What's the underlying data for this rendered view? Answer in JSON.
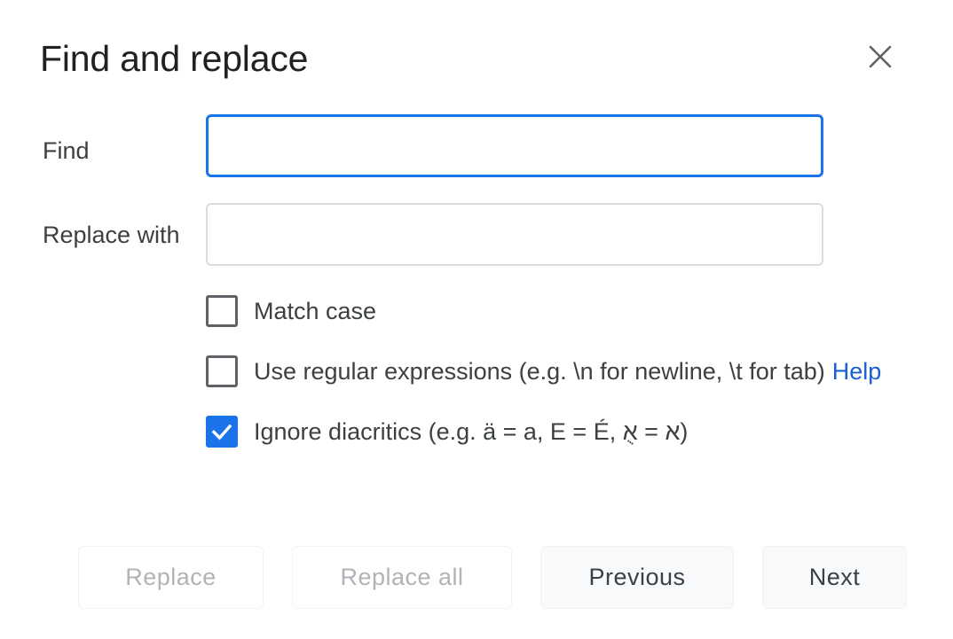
{
  "dialog": {
    "title": "Find and replace"
  },
  "find": {
    "label": "Find",
    "value": "",
    "placeholder": ""
  },
  "replace": {
    "label": "Replace with",
    "value": "",
    "placeholder": ""
  },
  "options": {
    "match_case": {
      "label": "Match case",
      "checked": false
    },
    "regex": {
      "label": "Use regular expressions (e.g. \\n for newline, \\t for tab)",
      "checked": false,
      "help_link": "Help"
    },
    "diacritics": {
      "label": "Ignore diacritics (e.g. ä = a, E = É, א = אֻ)",
      "checked": true
    }
  },
  "buttons": {
    "replace": "Replace",
    "replace_all": "Replace all",
    "previous": "Previous",
    "next": "Next"
  },
  "colors": {
    "accent": "#1a73e8",
    "link": "#1a5fd1",
    "text": "#3c4043",
    "disabled_text": "#b0b3b7"
  },
  "icons": {
    "close": "close-icon",
    "check": "checkmark-icon"
  }
}
